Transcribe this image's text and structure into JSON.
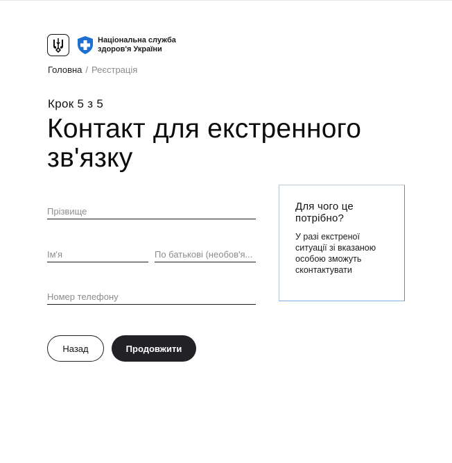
{
  "header": {
    "org_name_line1": "Національна служба",
    "org_name_line2": "здоров'я України",
    "logos": [
      "trident-icon",
      "nszu-shield-cross-icon"
    ]
  },
  "breadcrumb": {
    "home": "Головна",
    "separator": "/",
    "current": "Реєстрація"
  },
  "main": {
    "step": "Крок 5 з 5",
    "title": "Контакт для екстренного зв'язку"
  },
  "form": {
    "surname": {
      "placeholder": "Прізвище",
      "value": ""
    },
    "name": {
      "placeholder": "Ім'я",
      "value": ""
    },
    "patronymic": {
      "placeholder": "По батькові (необов'я...",
      "value": ""
    },
    "phone": {
      "placeholder": "Номер телефону",
      "value": ""
    }
  },
  "info": {
    "title": "Для чого це потрібно?",
    "text": "У разі екстреної ситуації зі вказаною особою зможуть сконтактувати"
  },
  "buttons": {
    "back": "Назад",
    "continue": "Продовжити"
  },
  "colors": {
    "brand_blue": "#1f6fd1",
    "primary_button": "#222226",
    "info_border_accent": "#4b8fd8"
  }
}
